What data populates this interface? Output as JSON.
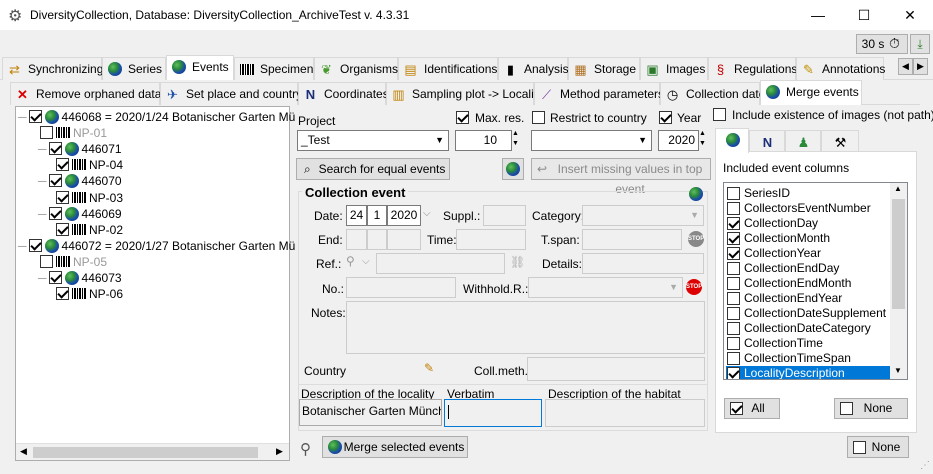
{
  "window": {
    "title": "DiversityCollection,  Database: DiversityCollection_ArchiveTest   v. 4.3.31"
  },
  "toolbar": {
    "timer": "30 s"
  },
  "main_tabs": [
    "Synchronizing",
    "Series",
    "Events",
    "Specimen",
    "Organisms",
    "Identifications",
    "Analysis",
    "Storage",
    "Images",
    "Regulations",
    "Annotations"
  ],
  "sub_tabs": [
    "Remove orphaned data",
    "Set place and country",
    "Coordinates",
    "Sampling plot -> Locality",
    "Method parameters",
    "Collection date",
    "Merge events"
  ],
  "tree": [
    {
      "text": "446068 = 2020/1/24 Botanischer Garten Mü",
      "level": 0
    },
    {
      "text": "NP-01",
      "level": 1,
      "grey": true
    },
    {
      "text": "446071",
      "level": 1
    },
    {
      "text": "NP-04",
      "level": 2
    },
    {
      "text": "446070",
      "level": 1
    },
    {
      "text": "NP-03",
      "level": 2
    },
    {
      "text": "446069",
      "level": 1
    },
    {
      "text": "NP-02",
      "level": 2
    },
    {
      "text": "446072 = 2020/1/27 Botanischer Garten Mü",
      "level": 0
    },
    {
      "text": "NP-05",
      "level": 1,
      "grey": true
    },
    {
      "text": "446073",
      "level": 1
    },
    {
      "text": "NP-06",
      "level": 2
    }
  ],
  "filters": {
    "project_label": "Project",
    "project_value": "_Test",
    "max_res_label": "Max. res.",
    "max_res_value": "10",
    "restrict_label": "Restrict to country",
    "year_label": "Year",
    "year_value": "2020",
    "images_label": "Include existence of images (not path)"
  },
  "buttons": {
    "search": "Search for equal events",
    "insert": "Insert missing values in top event",
    "merge": "Merge selected events",
    "all": "All",
    "none": "None",
    "none2": "None"
  },
  "event": {
    "heading": "Collection event",
    "date_label": "Date:",
    "day": "24",
    "month": "1",
    "year": "2020",
    "suppl_label": "Suppl.:",
    "category_label": "Category:",
    "end_label": "End:",
    "time_label": "Time:",
    "tspan_label": "T.span:",
    "ref_label": "Ref.:",
    "details_label": "Details:",
    "no_label": "No.:",
    "withhold_label": "Withhold.R.:",
    "notes_label": "Notes:",
    "country_label": "Country:",
    "collmeth_label": "Coll.meth.:",
    "locality_label": "Description of the locality",
    "locality_value": "Botanischer Garten München",
    "verbatim_label": "Verbatim",
    "habitat_label": "Description of the habitat"
  },
  "columns_panel": {
    "title": "Included event columns",
    "items": [
      {
        "name": "SeriesID",
        "checked": false
      },
      {
        "name": "CollectorsEventNumber",
        "checked": false
      },
      {
        "name": "CollectionDay",
        "checked": true
      },
      {
        "name": "CollectionMonth",
        "checked": true
      },
      {
        "name": "CollectionYear",
        "checked": true
      },
      {
        "name": "CollectionEndDay",
        "checked": false
      },
      {
        "name": "CollectionEndMonth",
        "checked": false
      },
      {
        "name": "CollectionEndYear",
        "checked": false
      },
      {
        "name": "CollectionDateSupplement",
        "checked": false
      },
      {
        "name": "CollectionDateCategory",
        "checked": false
      },
      {
        "name": "CollectionTime",
        "checked": false
      },
      {
        "name": "CollectionTimeSpan",
        "checked": false
      },
      {
        "name": "LocalityDescription",
        "checked": true,
        "selected": true
      }
    ]
  }
}
